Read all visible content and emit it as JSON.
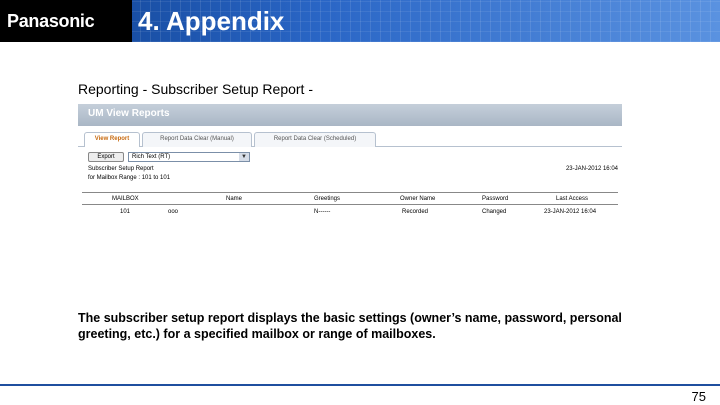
{
  "header": {
    "logo": "Panasonic",
    "title": "4. Appendix"
  },
  "subtitle": "Reporting - Subscriber Setup Report -",
  "screenshot": {
    "window_title": "UM View Reports",
    "tabs": [
      {
        "label": "View Report",
        "active": true
      },
      {
        "label": "Report Data Clear (Manual)",
        "active": false
      },
      {
        "label": "Report Data Clear (Scheduled)",
        "active": false
      }
    ],
    "export_label": "Export",
    "format_value": "Rich Text (RT)",
    "report_name": "Subscriber Setup Report",
    "mailbox_range": "for Mailbox Range : 101 to 101",
    "timestamp": "23-JAN-2012 16:04",
    "columns": [
      "MAILBOX",
      "Name",
      "Greetings",
      "Owner Name",
      "Password",
      "Last Access"
    ],
    "rows": [
      [
        "101",
        "ooo",
        "N------",
        "Recorded",
        "Changed",
        "23-JAN-2012 16:04"
      ]
    ]
  },
  "description": "The subscriber setup report displays the basic settings (owner’s name, password, personal greeting, etc.) for a specified mailbox or range of mailboxes.",
  "page_number": "75",
  "colors": {
    "header_dark": "#0d3f8e",
    "header_light": "#5a92e0",
    "accent_tab": "#c86a10",
    "footer_rule": "#1f4f9f"
  }
}
